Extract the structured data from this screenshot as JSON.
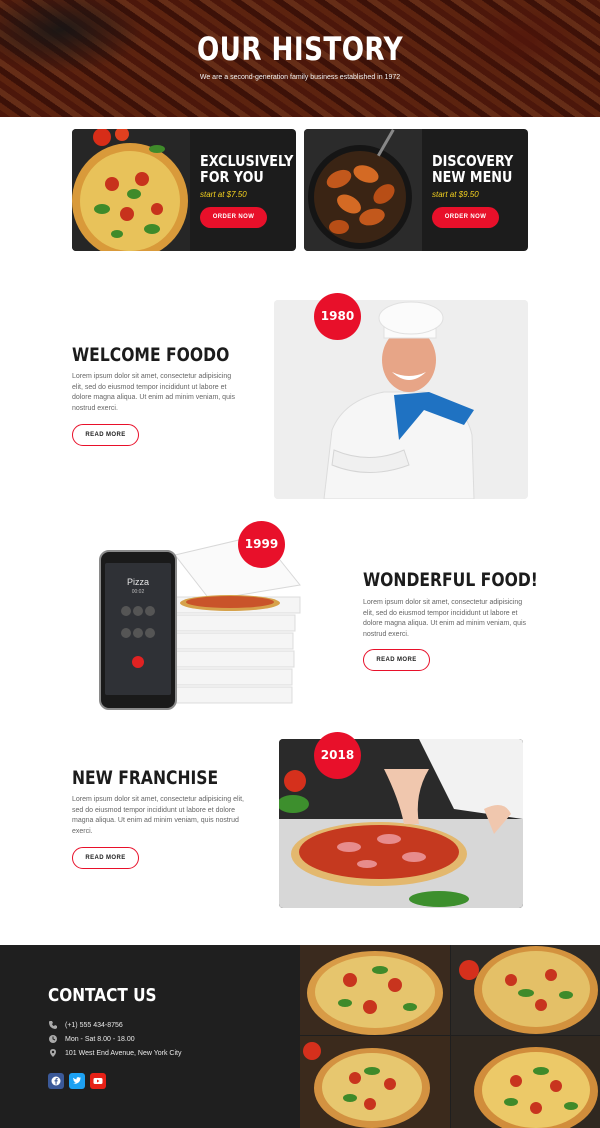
{
  "hero": {
    "title": "OUR HISTORY",
    "subtitle": "We are a second-generation family business established in 1972"
  },
  "promos": [
    {
      "title_line1": "EXCLUSIVELY",
      "title_line2": "FOR YOU",
      "price": "start at $7.50",
      "button": "ORDER NOW"
    },
    {
      "title_line1": "DISCOVERY",
      "title_line2": "NEW MENU",
      "price": "start at $9.50",
      "button": "ORDER NOW"
    }
  ],
  "sections": [
    {
      "title": "WELCOME FOODO",
      "text": "Lorem ipsum dolor sit amet, consectetur adipisicing elit, sed do eiusmod tempor incididunt ut labore et dolore magna aliqua. Ut enim ad minim veniam, quis nostrud exerci.",
      "button": "READ MORE",
      "year": "1980"
    },
    {
      "title": "WONDERFUL FOOD!",
      "text": "Lorem ipsum dolor sit amet, consectetur adipisicing elit, sed do eiusmod tempor incididunt ut labore et dolore magna aliqua. Ut enim ad minim veniam, quis nostrud exerci.",
      "button": "READ MORE",
      "year": "1999",
      "phone_label": "Pizza",
      "phone_time": "00:02"
    },
    {
      "title": "NEW FRANCHISE",
      "text": "Lorem ipsum dolor sit amet, consectetur adipisicing elit, sed do eiusmod tempor incididunt ut labore et dolore magna aliqua. Ut enim ad minim veniam, quis nostrud exerci.",
      "button": "READ MORE",
      "year": "2018"
    }
  ],
  "footer": {
    "title": "CONTACT US",
    "phone": "(+1) 555 434-8756",
    "hours": "Mon - Sat 8.00 - 18.00",
    "address": "101 West End Avenue, New York City",
    "socials": [
      {
        "icon": "facebook-icon",
        "color": "#3b5998"
      },
      {
        "icon": "twitter-icon",
        "color": "#1da1f2"
      },
      {
        "icon": "youtube-icon",
        "color": "#e62117"
      }
    ]
  },
  "colors": {
    "accent": "#e8102a",
    "price": "#f5d21f",
    "dark": "#1f1f1f"
  }
}
